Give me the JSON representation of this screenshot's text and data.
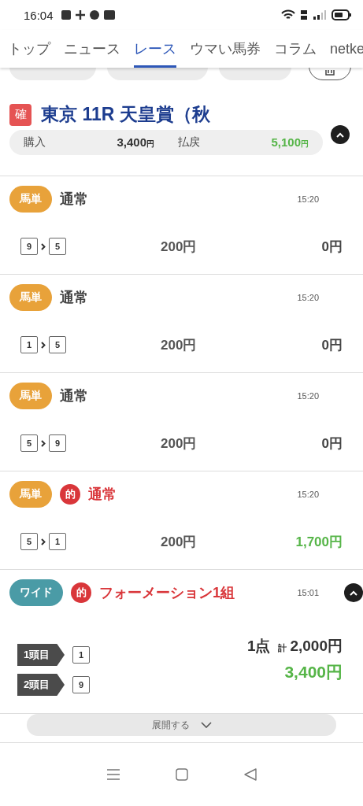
{
  "status_bar": {
    "time": "16:04"
  },
  "tabs": [
    {
      "label": "トップ",
      "selected": false
    },
    {
      "label": "ニュース",
      "selected": false
    },
    {
      "label": "レース",
      "selected": true
    },
    {
      "label": "ウマい馬券",
      "selected": false
    },
    {
      "label": "コラム",
      "selected": false
    },
    {
      "label": "netke",
      "selected": false
    }
  ],
  "race": {
    "badge": "確",
    "title": "東京 11R 天皇賞（秋",
    "expanded": true,
    "purchase_label": "購入",
    "purchase": "3,400",
    "purchase_unit": "円",
    "payout_label": "払戻",
    "payout": "5,100",
    "payout_unit": "円"
  },
  "bets": [
    {
      "kind": "single",
      "type": "馬単",
      "color": "#e8a23a",
      "hit": false,
      "name": "通常",
      "time": "15:20",
      "numbers": [
        "9",
        "5"
      ],
      "stake": "200円",
      "payout": "0円"
    },
    {
      "kind": "single",
      "type": "馬単",
      "color": "#e8a23a",
      "hit": false,
      "name": "通常",
      "time": "15:20",
      "numbers": [
        "1",
        "5"
      ],
      "stake": "200円",
      "payout": "0円"
    },
    {
      "kind": "single",
      "type": "馬単",
      "color": "#e8a23a",
      "hit": false,
      "name": "通常",
      "time": "15:20",
      "numbers": [
        "5",
        "9"
      ],
      "stake": "200円",
      "payout": "0円"
    },
    {
      "kind": "single",
      "type": "馬単",
      "color": "#e8a23a",
      "hit": true,
      "hit_mark": "的",
      "name": "通常",
      "time": "15:20",
      "numbers": [
        "5",
        "1"
      ],
      "stake": "200円",
      "payout": "1,700円"
    },
    {
      "kind": "formation",
      "type": "ワイド",
      "color": "#4a9ba6",
      "hit": true,
      "hit_mark": "的",
      "name": "フォーメーション1組",
      "time": "15:01",
      "expanded": true,
      "legs": [
        {
          "label": "1頭目",
          "numbers": [
            "1"
          ]
        },
        {
          "label": "2頭目",
          "numbers": [
            "9"
          ]
        }
      ],
      "points": "1点",
      "total_prefix": "計",
      "total": "2,000円",
      "payout": "3,400円"
    }
  ],
  "expand_button": {
    "label": "展開する"
  }
}
